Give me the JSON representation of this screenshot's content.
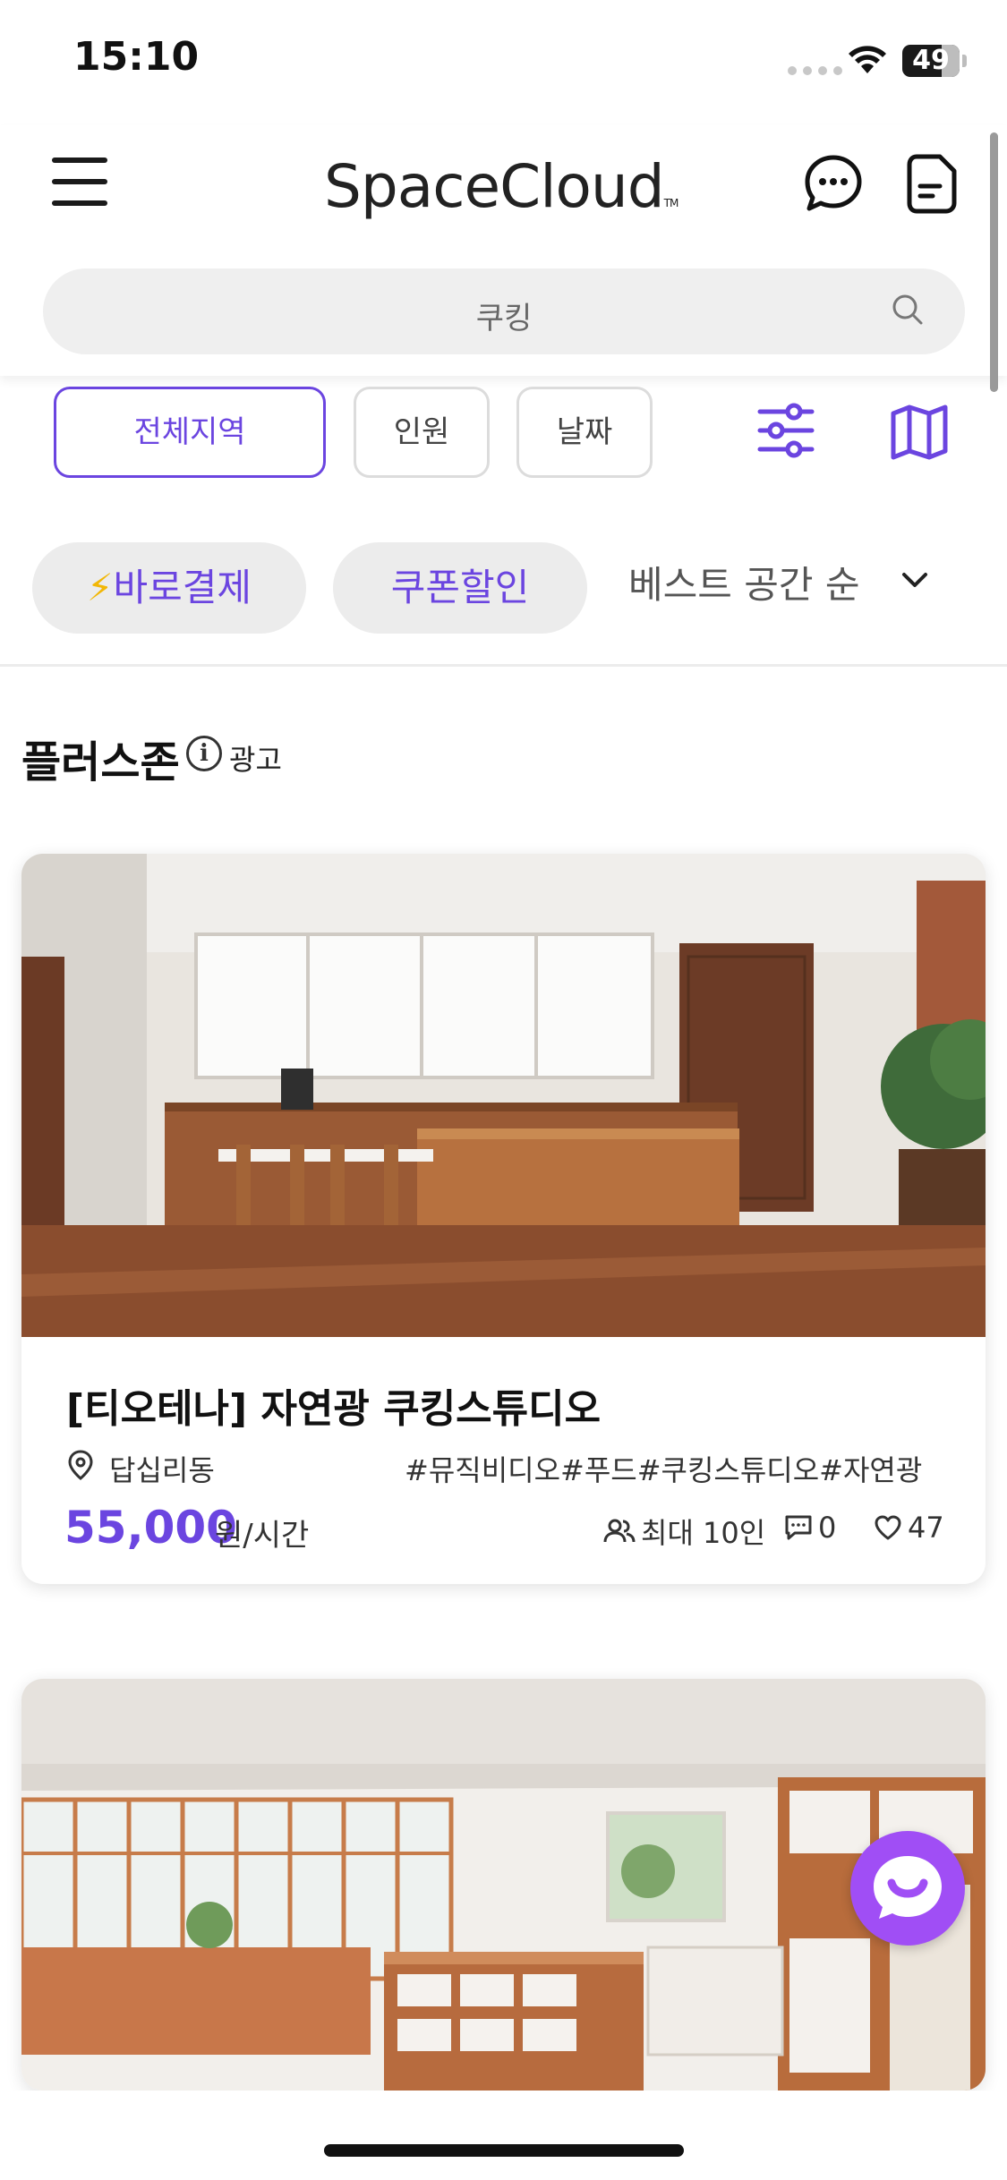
{
  "status_bar": {
    "time": "15:10",
    "battery": "49",
    "battery_fraction": 0.49
  },
  "header": {
    "logo": "SpaceCloud",
    "logo_tm": "TM",
    "search": {
      "value": "쿠킹"
    }
  },
  "filters": {
    "chips": [
      {
        "label": "전체지역",
        "active": true
      },
      {
        "label": "인원",
        "active": false
      },
      {
        "label": "날짜",
        "active": false
      }
    ],
    "pills": [
      {
        "label": "바로결제",
        "icon": "lightning-bolt-icon"
      },
      {
        "label": "쿠폰할인"
      }
    ],
    "sort": "베스트 공간 순"
  },
  "section": {
    "title": "플러스존",
    "ad_label": "광고"
  },
  "listings": [
    {
      "title": "[티오테나] 자연광 쿠킹스튜디오",
      "location": "답십리동",
      "tags": "#뮤직비디오#푸드#쿠킹스튜디오#자연광",
      "price": "55,000",
      "unit": "원/시간",
      "capacity": "최대 10인",
      "comments": "0",
      "likes": "47"
    },
    {}
  ],
  "colors": {
    "accent": "#6b45e0",
    "fab": "#a04ef5",
    "bolt": "#f2b705"
  }
}
